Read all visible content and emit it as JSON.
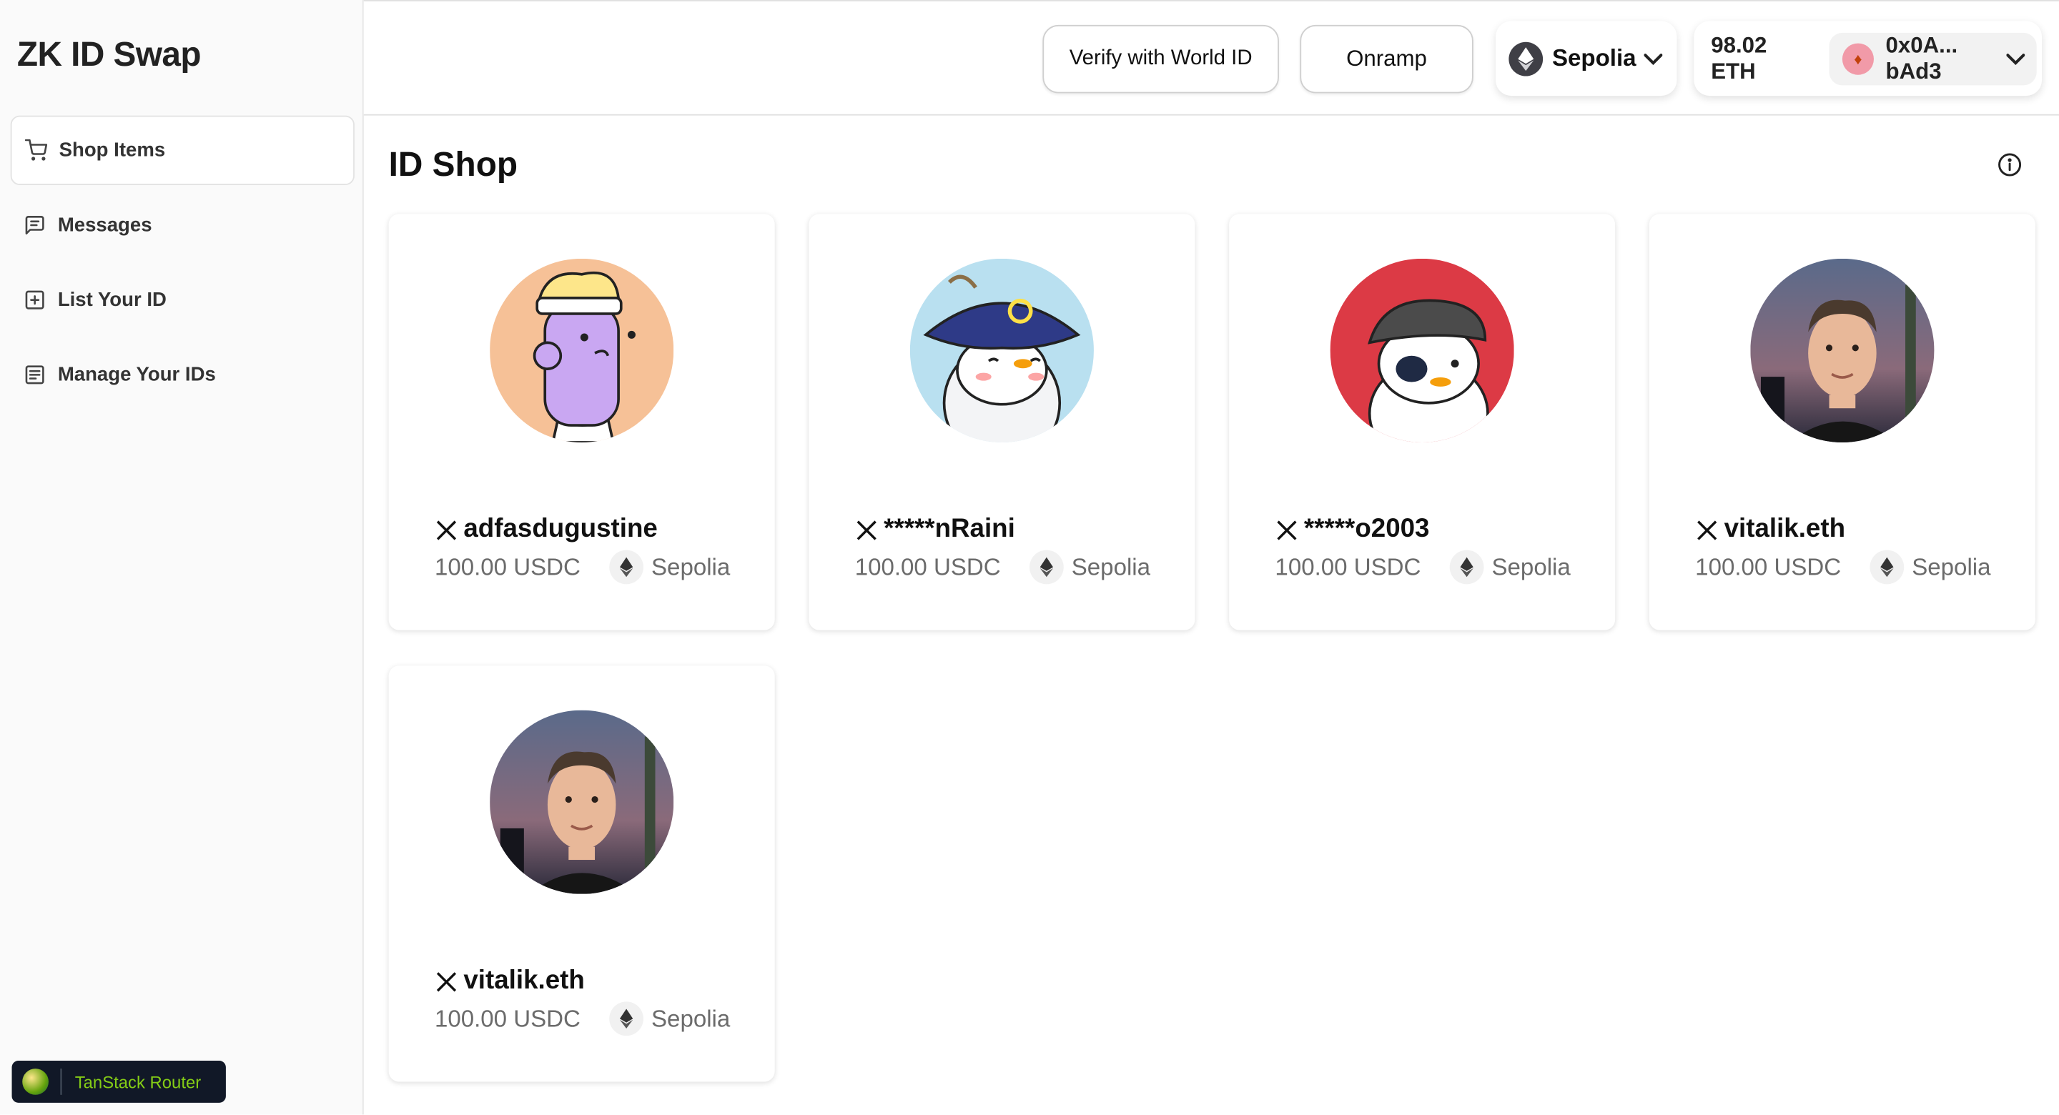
{
  "app": {
    "title": "ZK ID Swap"
  },
  "sidebar": {
    "items": [
      {
        "label": "Shop Items",
        "icon": "cart-icon",
        "active": true
      },
      {
        "label": "Messages",
        "icon": "message-icon",
        "active": false
      },
      {
        "label": "List Your ID",
        "icon": "plus-square-icon",
        "active": false
      },
      {
        "label": "Manage Your IDs",
        "icon": "list-icon",
        "active": false
      }
    ],
    "devtools_label": "TanStack Router"
  },
  "header": {
    "verify_label": "Verify with World ID",
    "onramp_label": "Onramp",
    "network": "Sepolia",
    "balance_amount": "98.02",
    "balance_unit": "ETH",
    "address_line1": "0x0A...",
    "address_line2": "bAd3"
  },
  "main": {
    "title": "ID Shop",
    "items": [
      {
        "handle": "adfasdugustine",
        "price": "100.00 USDC",
        "chain": "Sepolia",
        "avatar": "cartoon-headband"
      },
      {
        "handle": "*****nRaini",
        "price": "100.00 USDC",
        "chain": "Sepolia",
        "avatar": "penguin-pirate"
      },
      {
        "handle": "*****o2003",
        "price": "100.00 USDC",
        "chain": "Sepolia",
        "avatar": "penguin-eyepatch"
      },
      {
        "handle": "vitalik.eth",
        "price": "100.00 USDC",
        "chain": "Sepolia",
        "avatar": "person-photo"
      },
      {
        "handle": "vitalik.eth",
        "price": "100.00 USDC",
        "chain": "Sepolia",
        "avatar": "person-photo"
      }
    ]
  },
  "colors": {
    "accent_green": "#84cc16",
    "border": "#e6e6e6",
    "text_muted": "#6b6b6b"
  }
}
